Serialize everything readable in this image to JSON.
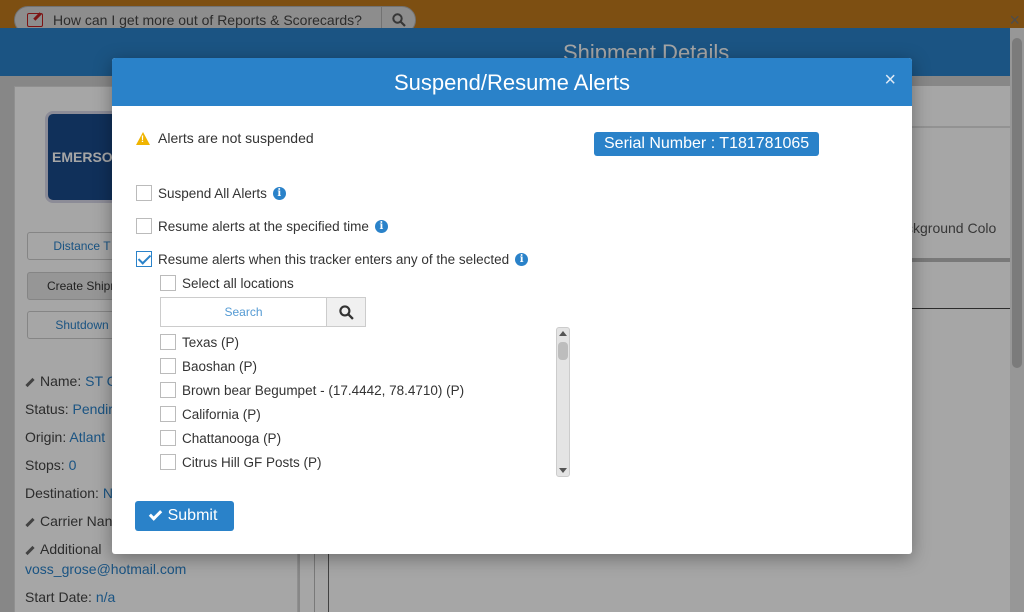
{
  "background": {
    "help_search_text": "How can I get more out of Reports & Scorecards?",
    "page_title": "Shipment Details",
    "logo_text": "EMERSO",
    "left_buttons": [
      "Distance T",
      "Create Shipn",
      "Shutdown"
    ],
    "fields": {
      "name_label": "Name:",
      "name_value": "ST C",
      "status_label": "Status:",
      "status_value": "Pendir",
      "origin_label": "Origin:",
      "origin_value": "Atlant",
      "stops_label": "Stops:",
      "stops_value": "0",
      "destination_label": "Destination:",
      "destination_value": "N",
      "carrier_label": "Carrier Nan",
      "additional_label": "Additional",
      "email_value": "voss_grose@hotmail.com",
      "start_date_label": "Start Date:",
      "start_date_value": "n/a"
    },
    "right_text": "ckground Colo"
  },
  "modal": {
    "title": "Suspend/Resume Alerts",
    "close_symbol": "×",
    "status_text": "Alerts are not suspended",
    "serial_label": "Serial Number : T181781065",
    "options": [
      {
        "label": "Suspend All Alerts",
        "checked": false
      },
      {
        "label": "Resume alerts at the specified time",
        "checked": false
      },
      {
        "label": "Resume alerts when this tracker enters any of the selected",
        "checked": true
      }
    ],
    "select_all_label": "Select all locations",
    "search_placeholder": "Search",
    "locations": [
      "Texas (P)",
      "Baoshan (P)",
      "Brown bear Begumpet - (17.4442, 78.4710) (P)",
      "California (P)",
      "Chattanooga (P)",
      "Citrus Hill GF Posts (P)"
    ],
    "submit_label": "Submit"
  }
}
